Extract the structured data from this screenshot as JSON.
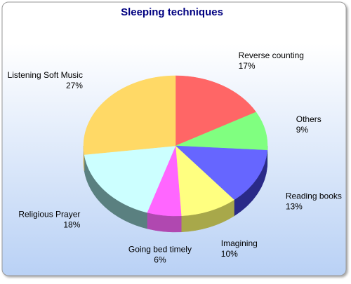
{
  "chart_data": {
    "type": "pie",
    "title": "Sleeping techniques",
    "style": "3d",
    "start_angle_deg": 90,
    "direction": "clockwise",
    "slices": [
      {
        "label": "Reverse counting",
        "value": 17,
        "display": "17%",
        "color": "#ff6666",
        "side_color": "#cc4c4c"
      },
      {
        "label": "Others",
        "value": 9,
        "display": "9%",
        "color": "#80ff80",
        "side_color": "#60c060"
      },
      {
        "label": "Reading books",
        "value": 13,
        "display": "13%",
        "color": "#6666ff",
        "side_color": "#2a2a88"
      },
      {
        "label": "Imagining",
        "value": 10,
        "display": "10%",
        "color": "#ffff80",
        "side_color": "#a8a84a"
      },
      {
        "label": "Going bed timely",
        "value": 6,
        "display": "6%",
        "color": "#ff66ff",
        "side_color": "#b048b0"
      },
      {
        "label": "Religious Prayer",
        "value": 18,
        "display": "18%",
        "color": "#ccffff",
        "side_color": "#5a8080"
      },
      {
        "label": "Listening Soft Music",
        "value": 27,
        "display": "27%",
        "color": "#ffd966",
        "side_color": "#c7a748"
      }
    ]
  },
  "colors": {
    "title": "#000080",
    "background_top": "#ffffff",
    "background_bottom": "#b9d1f5",
    "frame": "#999999",
    "label_text": "#000000"
  }
}
